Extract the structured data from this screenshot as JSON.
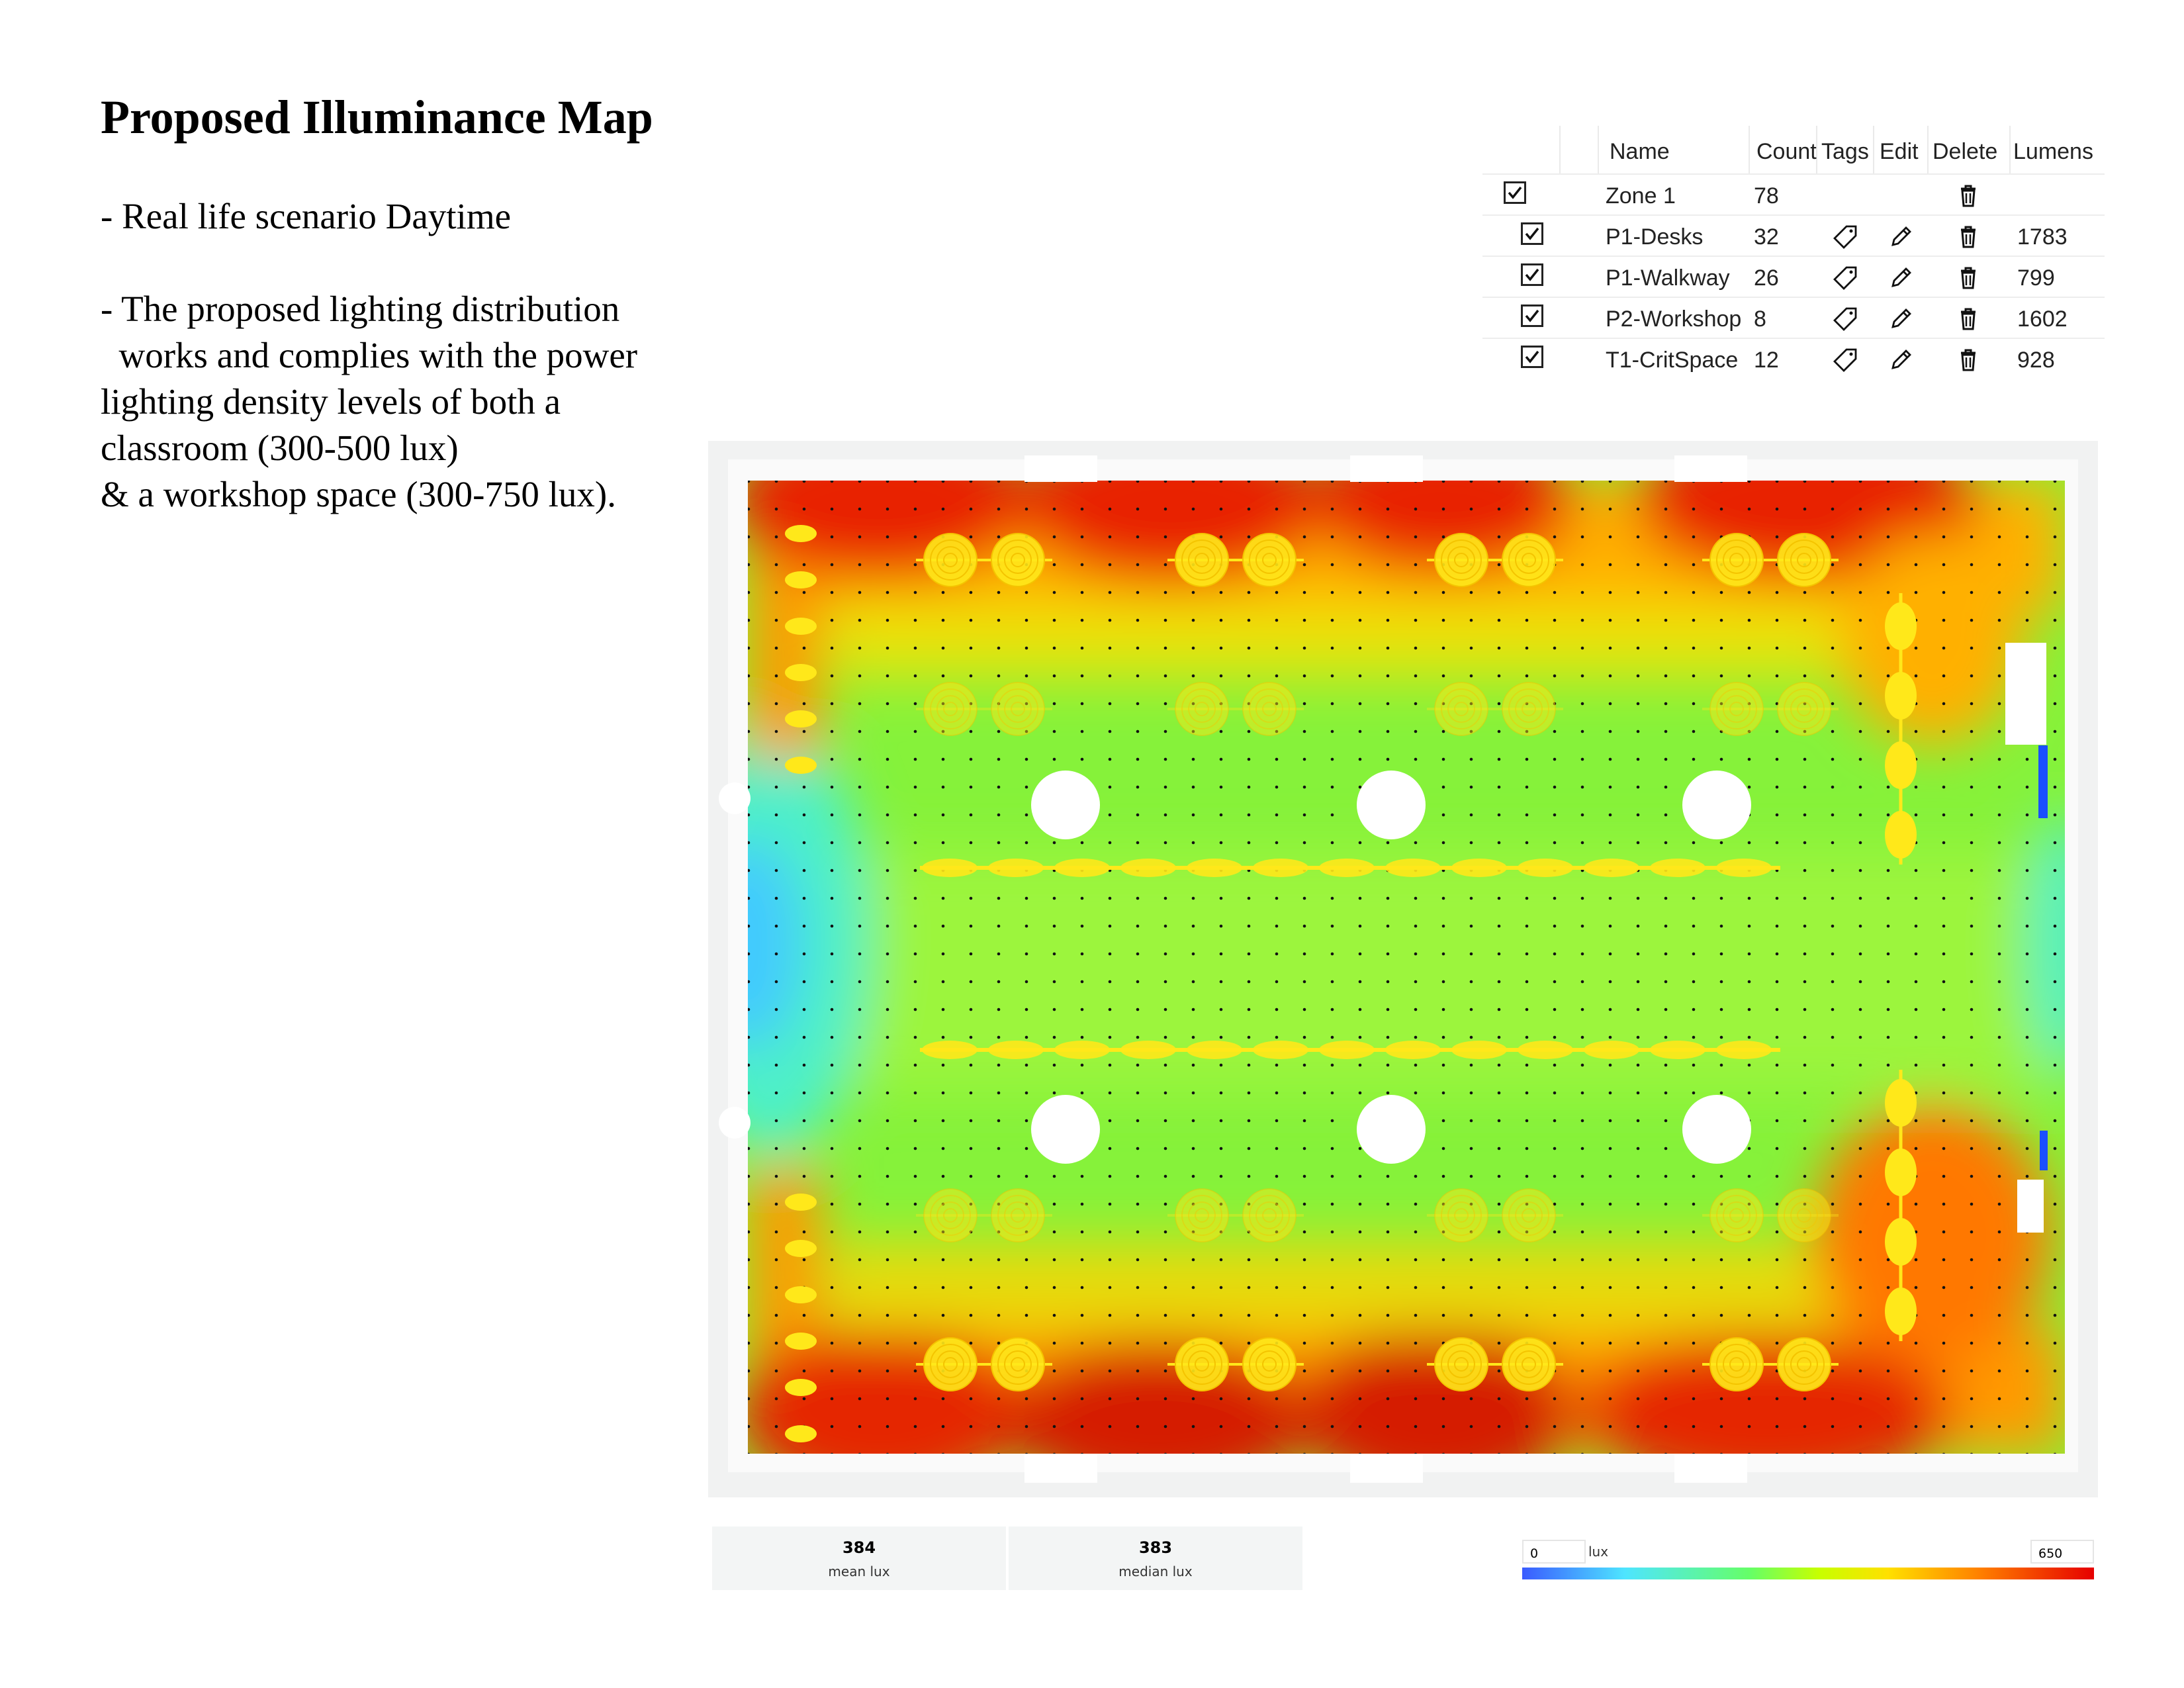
{
  "page": {
    "title": "Proposed Illuminance Map",
    "description_1": "- Real life scenario Daytime",
    "description_2": "- The proposed lighting distribution\n  works and complies with the power\nlighting density levels of both a\nclassroom (300-500 lux)\n& a workshop space (300-750 lux)."
  },
  "table": {
    "headers": {
      "name": "Name",
      "count": "Count",
      "tags": "Tags",
      "edit": "Edit",
      "delete": "Delete",
      "lumens": "Lumens"
    },
    "rows": [
      {
        "name": "Zone 1",
        "count": "78",
        "lumens": "",
        "checked": true,
        "level": 0
      },
      {
        "name": "P1-Desks",
        "count": "32",
        "lumens": "1783",
        "checked": true,
        "level": 1
      },
      {
        "name": "P1-Walkway",
        "count": "26",
        "lumens": "799",
        "checked": true,
        "level": 1
      },
      {
        "name": "P2-Workshop",
        "count": "8",
        "lumens": "1602",
        "checked": true,
        "level": 1
      },
      {
        "name": "T1-CritSpace",
        "count": "12",
        "lumens": "928",
        "checked": true,
        "level": 1
      }
    ]
  },
  "icons": {
    "check": "check-icon",
    "tag": "tag-icon",
    "edit": "pencil-icon",
    "delete": "trash-icon"
  },
  "stats": {
    "mean": {
      "value": "384",
      "label": "mean lux"
    },
    "median": {
      "value": "383",
      "label": "median lux"
    }
  },
  "legend": {
    "min": "0",
    "max": "650",
    "unit": "lux"
  },
  "colors": {
    "blue": "#3a5bff",
    "cyan": "#4ee5ff",
    "green": "#66ff66",
    "yellow_green": "#c8ff00",
    "yellow": "#ffe000",
    "orange": "#ff8000",
    "red": "#e60000",
    "luminaire": "#ffe81a"
  }
}
